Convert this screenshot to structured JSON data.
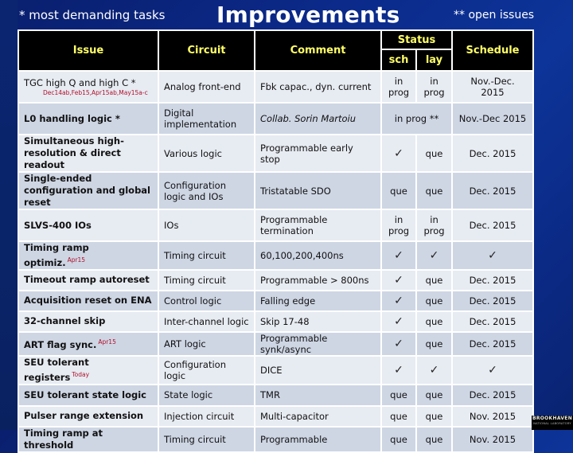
{
  "header": {
    "note_left": "* most demanding tasks",
    "title": "Improvements",
    "note_right": "** open issues"
  },
  "columns": {
    "issue": "Issue",
    "circuit": "Circuit",
    "comment": "Comment",
    "status": "Status",
    "sch": "sch",
    "lay": "lay",
    "schedule": "Schedule"
  },
  "icons": {
    "check": "✓"
  },
  "colors": {
    "header_bg": "#000000",
    "header_text": "#ffff66",
    "row_light": "#e7ebf2",
    "row_dark": "#ced6e4",
    "annotation": "#b0102a",
    "background": "#0b2a8a"
  },
  "rows": [
    {
      "issue": "TGC high Q and high C *",
      "issue_note": "Dec14ab,Feb15,Apr15ab,May15a-c",
      "circuit": "Analog front-end",
      "comment": "Fbk capac., dyn. current",
      "sch": "in prog",
      "lay": "in prog",
      "schedule": "Nov.-Dec. 2015"
    },
    {
      "issue": "L0 handling logic *",
      "circuit": "Digital implementation",
      "comment": "Collab. Sorin Martoiu",
      "status_merged": "in prog **",
      "schedule": "Nov.-Dec 2015"
    },
    {
      "issue": "Simultaneous high-resolution & direct readout",
      "circuit": "Various logic",
      "comment": "Programmable early stop",
      "sch": "✓",
      "lay": "que",
      "schedule": "Dec. 2015"
    },
    {
      "issue": "Single-ended configuration and global reset",
      "circuit": "Configuration logic and IOs",
      "comment": "Tristatable SDO",
      "sch": "que",
      "lay": "que",
      "schedule": "Dec. 2015"
    },
    {
      "issue": "SLVS-400 IOs",
      "circuit": "IOs",
      "comment": "Programmable termination",
      "sch": "in prog",
      "lay": "in prog",
      "schedule": "Dec. 2015"
    },
    {
      "issue": "Timing ramp optimiz.",
      "issue_sup": "Apr15",
      "circuit": "Timing circuit",
      "comment": "60,100,200,400ns",
      "sch": "✓",
      "lay": "✓",
      "schedule": "✓"
    },
    {
      "issue": "Timeout ramp autoreset",
      "circuit": "Timing circuit",
      "comment": "Programmable > 800ns",
      "sch": "✓",
      "lay": "que",
      "schedule": "Dec. 2015"
    },
    {
      "issue": "Acquisition reset on ENA",
      "circuit": "Control logic",
      "comment": "Falling edge",
      "sch": "✓",
      "lay": "que",
      "schedule": "Dec. 2015"
    },
    {
      "issue": "32-channel skip",
      "circuit": "Inter-channel logic",
      "comment": "Skip 17-48",
      "sch": "✓",
      "lay": "que",
      "schedule": "Dec. 2015"
    },
    {
      "issue": "ART flag sync.",
      "issue_sup": "Apr15",
      "circuit": "ART logic",
      "comment": "Programmable synk/async",
      "sch": "✓",
      "lay": "que",
      "schedule": "Dec. 2015"
    },
    {
      "issue": "SEU tolerant registers",
      "issue_sup": "Today",
      "circuit": "Configuration logic",
      "comment": "DICE",
      "sch": "✓",
      "lay": "✓",
      "schedule": "✓"
    },
    {
      "issue": "SEU tolerant state logic",
      "circuit": "State logic",
      "comment": "TMR",
      "sch": "que",
      "lay": "que",
      "schedule": "Dec. 2015"
    },
    {
      "issue": "Pulser range extension",
      "circuit": "Injection circuit",
      "comment": "Multi-capacitor",
      "sch": "que",
      "lay": "que",
      "schedule": "Nov. 2015"
    },
    {
      "issue": "Timing ramp at threshold",
      "circuit": "Timing circuit",
      "comment": "Programmable",
      "sch": "que",
      "lay": "que",
      "schedule": "Nov. 2015"
    }
  ],
  "logo": {
    "name": "BROOKHAVEN",
    "sub": "NATIONAL LABORATORY"
  }
}
